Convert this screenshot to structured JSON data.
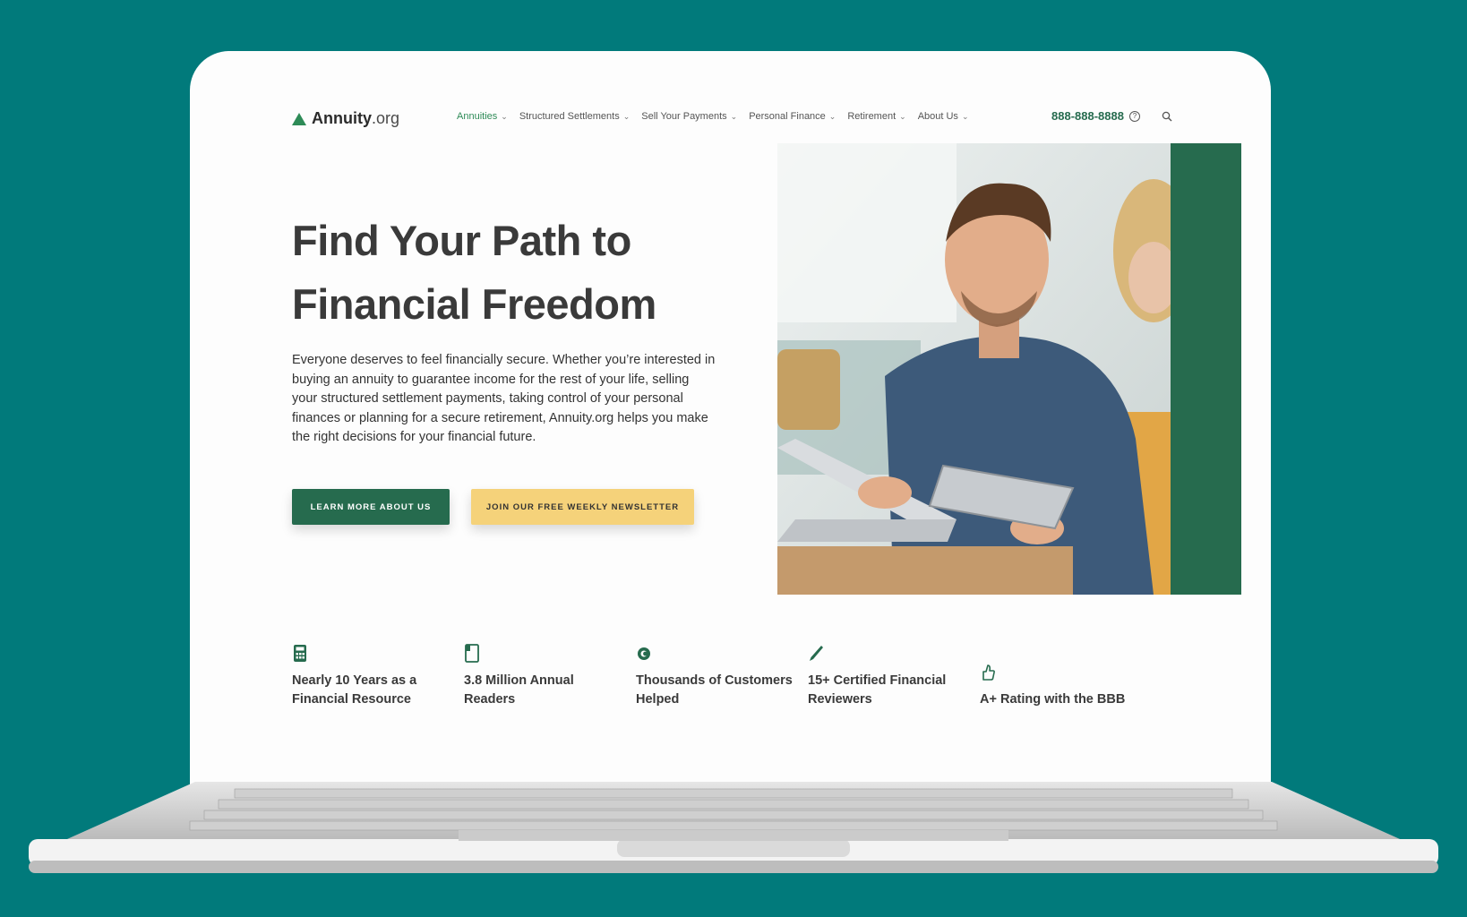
{
  "site": {
    "logo_name": "Annuity",
    "logo_tld": ".org",
    "phone": "888-888-8888"
  },
  "nav": {
    "items": [
      {
        "label": "Annuities"
      },
      {
        "label": "Structured Settlements"
      },
      {
        "label": "Sell Your Payments"
      },
      {
        "label": "Personal Finance"
      },
      {
        "label": "Retirement"
      },
      {
        "label": "About Us"
      }
    ]
  },
  "hero": {
    "title_line1": "Find Your Path to",
    "title_line2": "Financial Freedom",
    "body": "Everyone deserves to feel financially secure. Whether you’re interested in buying an annuity to guarantee income for the rest of your life, selling your structured settlement payments, taking control of your personal finances or planning for a secure retirement, Annuity.org helps you make the right decisions for your financial future.",
    "primary_button": "LEARN MORE ABOUT US",
    "secondary_button": "JOIN OUR FREE WEEKLY NEWSLETTER"
  },
  "stats": [
    {
      "icon": "calculator-icon",
      "label": "Nearly 10 Years as a Financial Resource"
    },
    {
      "icon": "book-icon",
      "label": "3.8 Million Annual Readers"
    },
    {
      "icon": "customers-icon",
      "label": "Thousands of Customers Helped"
    },
    {
      "icon": "pen-icon",
      "label": "15+ Certified Financial Reviewers"
    },
    {
      "icon": "thumbs-up-icon",
      "label": "A+ Rating with the BBB"
    }
  ],
  "colors": {
    "background": "#017a7b",
    "brand_green": "#266b4e",
    "accent_yellow": "#f5d27a"
  }
}
